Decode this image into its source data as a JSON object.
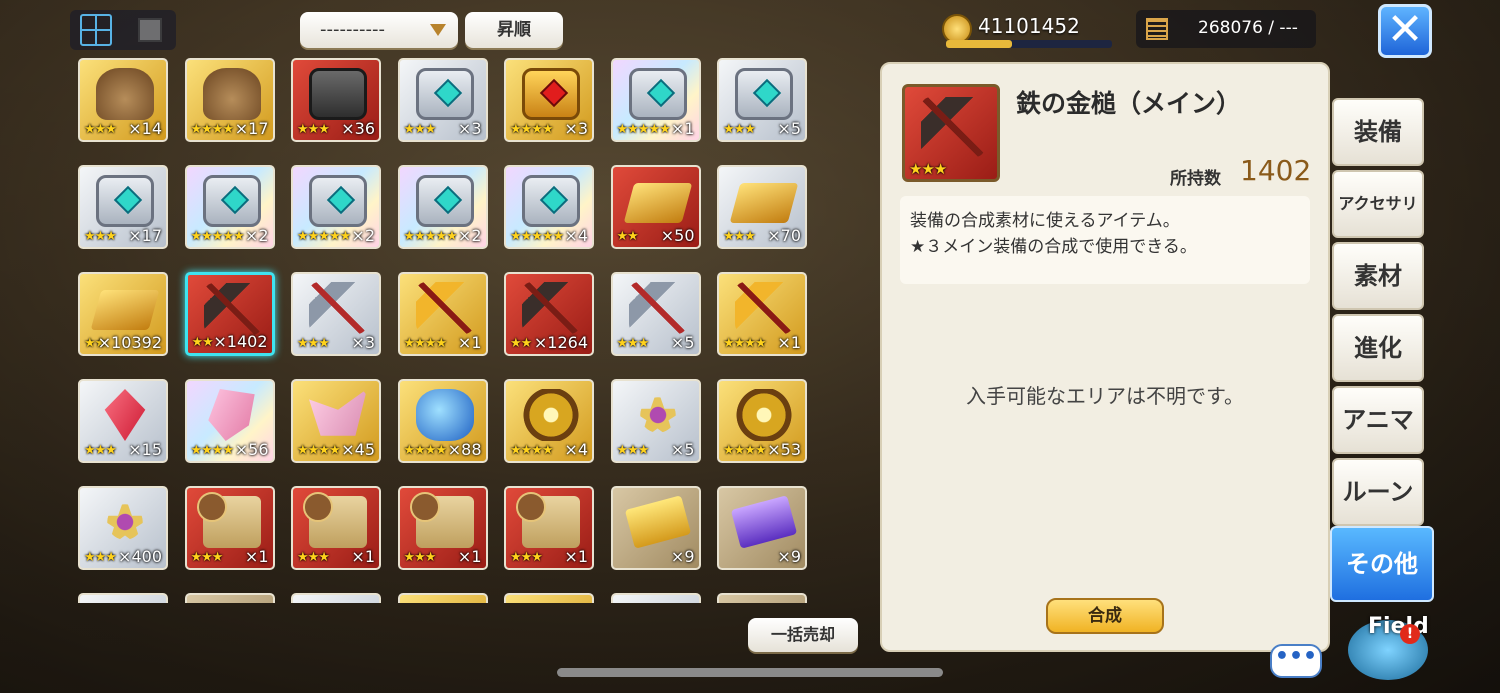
{
  "toolbar": {
    "sort_value": "----------",
    "order_label": "昇順",
    "gold": "41101452",
    "gold_bar_fraction": 0.4,
    "capacity": "268076 / ---",
    "bulk_sell_label": "一括売却"
  },
  "items": [
    {
      "bg": "gold",
      "pic": "bag",
      "stars": "★★★",
      "qty": "×14"
    },
    {
      "bg": "gold",
      "pic": "bag",
      "stars": "★★★★",
      "qty": "×17"
    },
    {
      "bg": "red",
      "pic": "chest dark",
      "stars": "★★★",
      "qty": "×36"
    },
    {
      "bg": "silver",
      "pic": "chest",
      "stars": "★★★",
      "qty": "×3"
    },
    {
      "bg": "gold",
      "pic": "chest goldchest",
      "stars": "★★★★",
      "qty": "×3"
    },
    {
      "bg": "rainbow",
      "pic": "chest",
      "stars": "★★★★★",
      "qty": "×1"
    },
    {
      "bg": "silver",
      "pic": "chest",
      "stars": "★★★",
      "qty": "×5"
    },
    {
      "bg": "silver",
      "pic": "chest",
      "stars": "★★★",
      "qty": "×17"
    },
    {
      "bg": "rainbow",
      "pic": "chest",
      "stars": "★★★★★",
      "qty": "×2"
    },
    {
      "bg": "rainbow",
      "pic": "chest",
      "stars": "★★★★★",
      "qty": "×2"
    },
    {
      "bg": "rainbow",
      "pic": "chest",
      "stars": "★★★★★",
      "qty": "×2"
    },
    {
      "bg": "rainbow",
      "pic": "chest",
      "stars": "★★★★★",
      "qty": "×4"
    },
    {
      "bg": "red",
      "pic": "ingot",
      "stars": "★★",
      "qty": "×50"
    },
    {
      "bg": "silver",
      "pic": "ingot",
      "stars": "★★★",
      "qty": "×70"
    },
    {
      "bg": "gold",
      "pic": "ingot",
      "stars": "★★",
      "qty": "×10392"
    },
    {
      "bg": "red",
      "pic": "hammer",
      "stars": "★★",
      "qty": "×1402",
      "selected": true
    },
    {
      "bg": "silver",
      "pic": "silverhammer",
      "stars": "★★★",
      "qty": "×3"
    },
    {
      "bg": "gold",
      "pic": "goldhammer",
      "stars": "★★★★",
      "qty": "×1"
    },
    {
      "bg": "red",
      "pic": "hammer",
      "stars": "★★",
      "qty": "×1264"
    },
    {
      "bg": "silver",
      "pic": "silverhammer",
      "stars": "★★★",
      "qty": "×5"
    },
    {
      "bg": "gold",
      "pic": "goldhammer",
      "stars": "★★★★",
      "qty": "×1"
    },
    {
      "bg": "silver",
      "pic": "crystal",
      "stars": "★★★",
      "qty": "×15"
    },
    {
      "bg": "rainbow",
      "pic": "gem",
      "stars": "★★★★",
      "qty": "×56"
    },
    {
      "bg": "gold",
      "pic": "gem2",
      "stars": "★★★★",
      "qty": "×45"
    },
    {
      "bg": "gold",
      "pic": "blue",
      "stars": "★★★★",
      "qty": "×88"
    },
    {
      "bg": "gold",
      "pic": "medal",
      "stars": "★★★★",
      "qty": "×4"
    },
    {
      "bg": "silver",
      "pic": "star",
      "stars": "★★★",
      "qty": "×5"
    },
    {
      "bg": "gold",
      "pic": "medal",
      "stars": "★★★★",
      "qty": "×53"
    },
    {
      "bg": "silver",
      "pic": "star",
      "stars": "★★★",
      "qty": "×400"
    },
    {
      "bg": "red",
      "pic": "scroll",
      "stars": "★★★",
      "qty": "×1"
    },
    {
      "bg": "red",
      "pic": "scroll",
      "stars": "★★★",
      "qty": "×1"
    },
    {
      "bg": "red",
      "pic": "scroll",
      "stars": "★★★",
      "qty": "×1"
    },
    {
      "bg": "red",
      "pic": "scroll",
      "stars": "★★★",
      "qty": "×1"
    },
    {
      "bg": "tan",
      "pic": "ticket",
      "stars": "",
      "qty": "×9"
    },
    {
      "bg": "tan",
      "pic": "ticket purple",
      "stars": "",
      "qty": "×9"
    },
    {
      "bg": "silver",
      "pic": "ghost",
      "stars": "",
      "qty": ""
    },
    {
      "bg": "tan",
      "pic": "ghost",
      "stars": "",
      "qty": ""
    },
    {
      "bg": "silver",
      "pic": "ghost",
      "stars": "",
      "qty": ""
    },
    {
      "bg": "gold",
      "pic": "ghost",
      "stars": "",
      "qty": ""
    },
    {
      "bg": "gold",
      "pic": "ghost",
      "stars": "",
      "qty": ""
    },
    {
      "bg": "silver",
      "pic": "ghost",
      "stars": "",
      "qty": ""
    },
    {
      "bg": "tan",
      "pic": "ghost",
      "stars": "",
      "qty": ""
    }
  ],
  "detail": {
    "name": "鉄の金槌（メイン）",
    "stars": "★★★",
    "owned_label": "所持数",
    "owned_value": "1402",
    "desc_line1": "装備の合成素材に使えるアイテム。",
    "desc_line2": "★３メイン装備の合成で使用できる。",
    "area_message": "入手可能なエリアは不明です。",
    "compose_label": "合成"
  },
  "tabs": [
    {
      "label": "装備"
    },
    {
      "label": "アクセサリ"
    },
    {
      "label": "素材"
    },
    {
      "label": "進化"
    },
    {
      "label": "アニマ"
    },
    {
      "label": "ルーン"
    },
    {
      "label": "その他",
      "active": true
    }
  ],
  "field": {
    "label": "Field",
    "badge": "!"
  },
  "chat": {
    "label": "•••"
  },
  "close_label": "✕"
}
